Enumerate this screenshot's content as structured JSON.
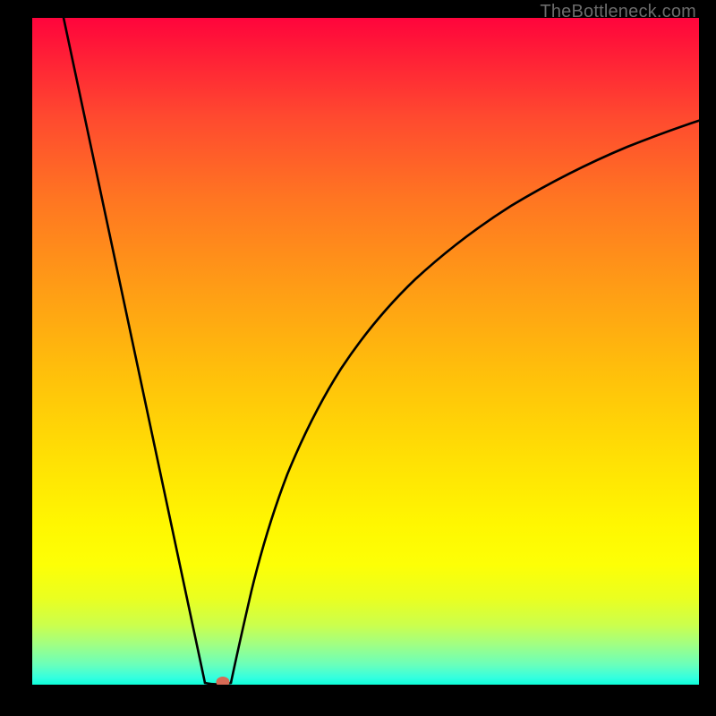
{
  "watermark": {
    "text": "TheBottleneck.com"
  },
  "colors": {
    "frame": "#000000",
    "curve": "#000000",
    "marker": "#d66a55",
    "watermark": "#6b6b6b"
  },
  "chart_data": {
    "type": "line",
    "title": "",
    "xlabel": "",
    "ylabel": "",
    "xlim": [
      0,
      100
    ],
    "ylim": [
      0,
      100
    ],
    "grid": false,
    "legend": false,
    "left_branch": {
      "x": [
        5,
        26
      ],
      "y": [
        100,
        0
      ]
    },
    "right_branch": {
      "x": [
        29.5,
        32,
        35,
        38,
        42,
        46,
        51,
        57,
        64,
        72,
        81,
        90,
        100
      ],
      "y": [
        0,
        12,
        22,
        30,
        38,
        45,
        52,
        59,
        65,
        71,
        76,
        80,
        84
      ]
    },
    "marker": {
      "x": 28.5,
      "y": 0,
      "color": "#d66a55"
    },
    "notes": "V-shaped performance bottleneck curve on rainbow heat gradient; no axis ticks or legend visible."
  }
}
